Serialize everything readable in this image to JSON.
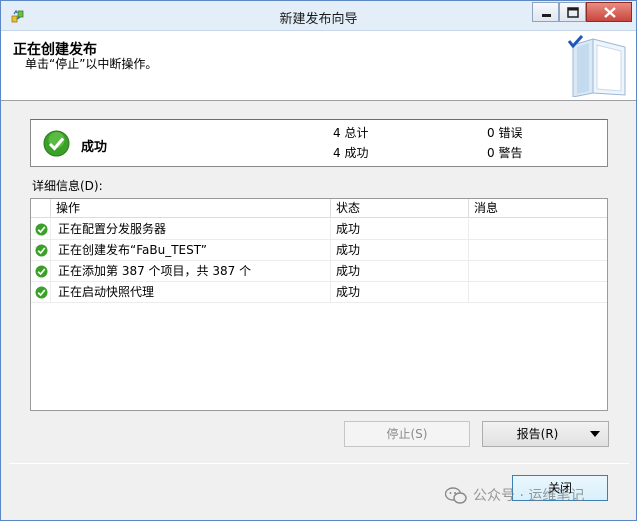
{
  "window": {
    "title": "新建发布向导"
  },
  "header": {
    "title": "正在创建发布",
    "subtitle": "单击“停止”以中断操作。"
  },
  "summary": {
    "status": "成功",
    "total_count": "4",
    "total_label": "总计",
    "success_count": "4",
    "success_label": "成功",
    "error_count": "0",
    "error_label": "错误",
    "warning_count": "0",
    "warning_label": "警告"
  },
  "details": {
    "label": "详细信息(D):",
    "columns": [
      "操作",
      "状态",
      "消息"
    ],
    "rows": [
      {
        "action": "正在配置分发服务器",
        "status": "成功",
        "message": ""
      },
      {
        "action": "正在创建发布“FaBu_TEST”",
        "status": "成功",
        "message": ""
      },
      {
        "action": "正在添加第 387 个项目，共 387 个",
        "status": "成功",
        "message": ""
      },
      {
        "action": "正在启动快照代理",
        "status": "成功",
        "message": ""
      }
    ]
  },
  "buttons": {
    "stop": "停止(S)",
    "report": "报告(R)",
    "close": "关闭"
  },
  "watermark": {
    "text": "公众号 · 运维笔记"
  },
  "icons": {
    "success": "check-circle-icon",
    "app": "wizard-app-icon",
    "header": "book-check-icon"
  },
  "colors": {
    "success_green": "#3aa028",
    "title_bar": "#e3eef9",
    "close_red": "#c9463d"
  }
}
